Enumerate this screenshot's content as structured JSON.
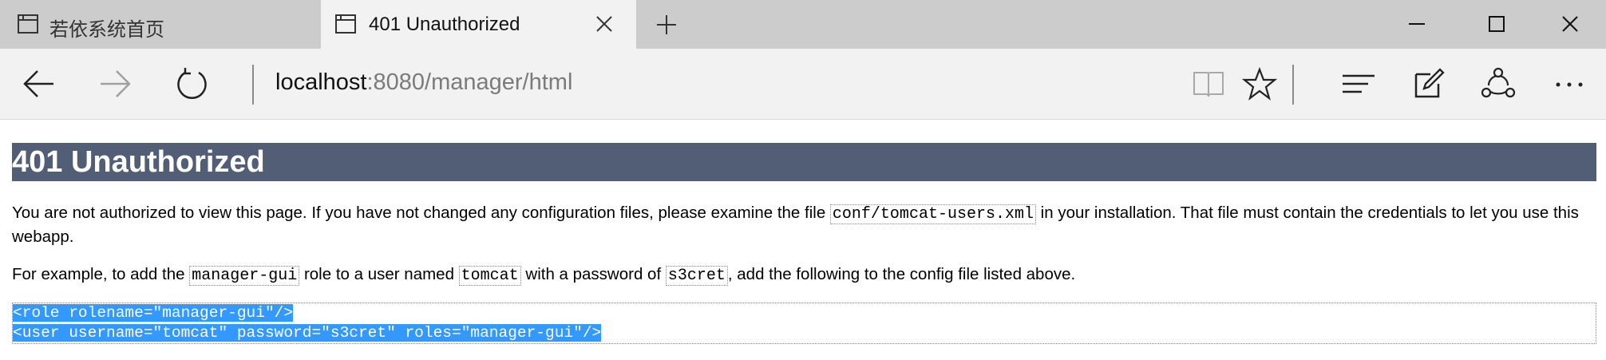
{
  "tabs": [
    {
      "title": "若依系统首页",
      "active": false
    },
    {
      "title": "401 Unauthorized",
      "active": true
    }
  ],
  "address": {
    "host": "localhost",
    "rest": ":8080/manager/html"
  },
  "page": {
    "heading": "401 Unauthorized",
    "p1": {
      "text_before": "You are not authorized to view this page. If you have not changed any configuration files, please examine the file ",
      "code": "conf/tomcat-users.xml",
      "text_after": " in your installation. That file must contain the credentials to let you use this webapp."
    },
    "p2": {
      "t1": "For example, to add the ",
      "c1": "manager-gui",
      "t2": " role to a user named ",
      "c2": "tomcat",
      "t3": " with a password of ",
      "c3": "s3cret",
      "t4": ", add the following to the config file listed above."
    },
    "config_lines": [
      "<role rolename=\"manager-gui\"/>",
      "<user username=\"tomcat\" password=\"s3cret\" roles=\"manager-gui\"/>"
    ]
  },
  "colors": {
    "tabbar_bg": "#cccccc",
    "toolbar_bg": "#f2f2f2",
    "heading_bg": "#525d76",
    "selection": "#3399ff"
  },
  "icons": {
    "tab": "tab-page-icon",
    "close": "close-icon",
    "new_tab": "plus-icon",
    "minimize": "minimize-icon",
    "maximize": "maximize-icon",
    "window_close": "window-close-icon",
    "back": "back-arrow-icon",
    "forward": "forward-arrow-icon",
    "refresh": "refresh-icon",
    "reading_view": "book-icon",
    "favorite": "star-icon",
    "hub": "hub-icon",
    "notes": "pen-icon",
    "share": "share-icon",
    "more": "more-icon"
  }
}
